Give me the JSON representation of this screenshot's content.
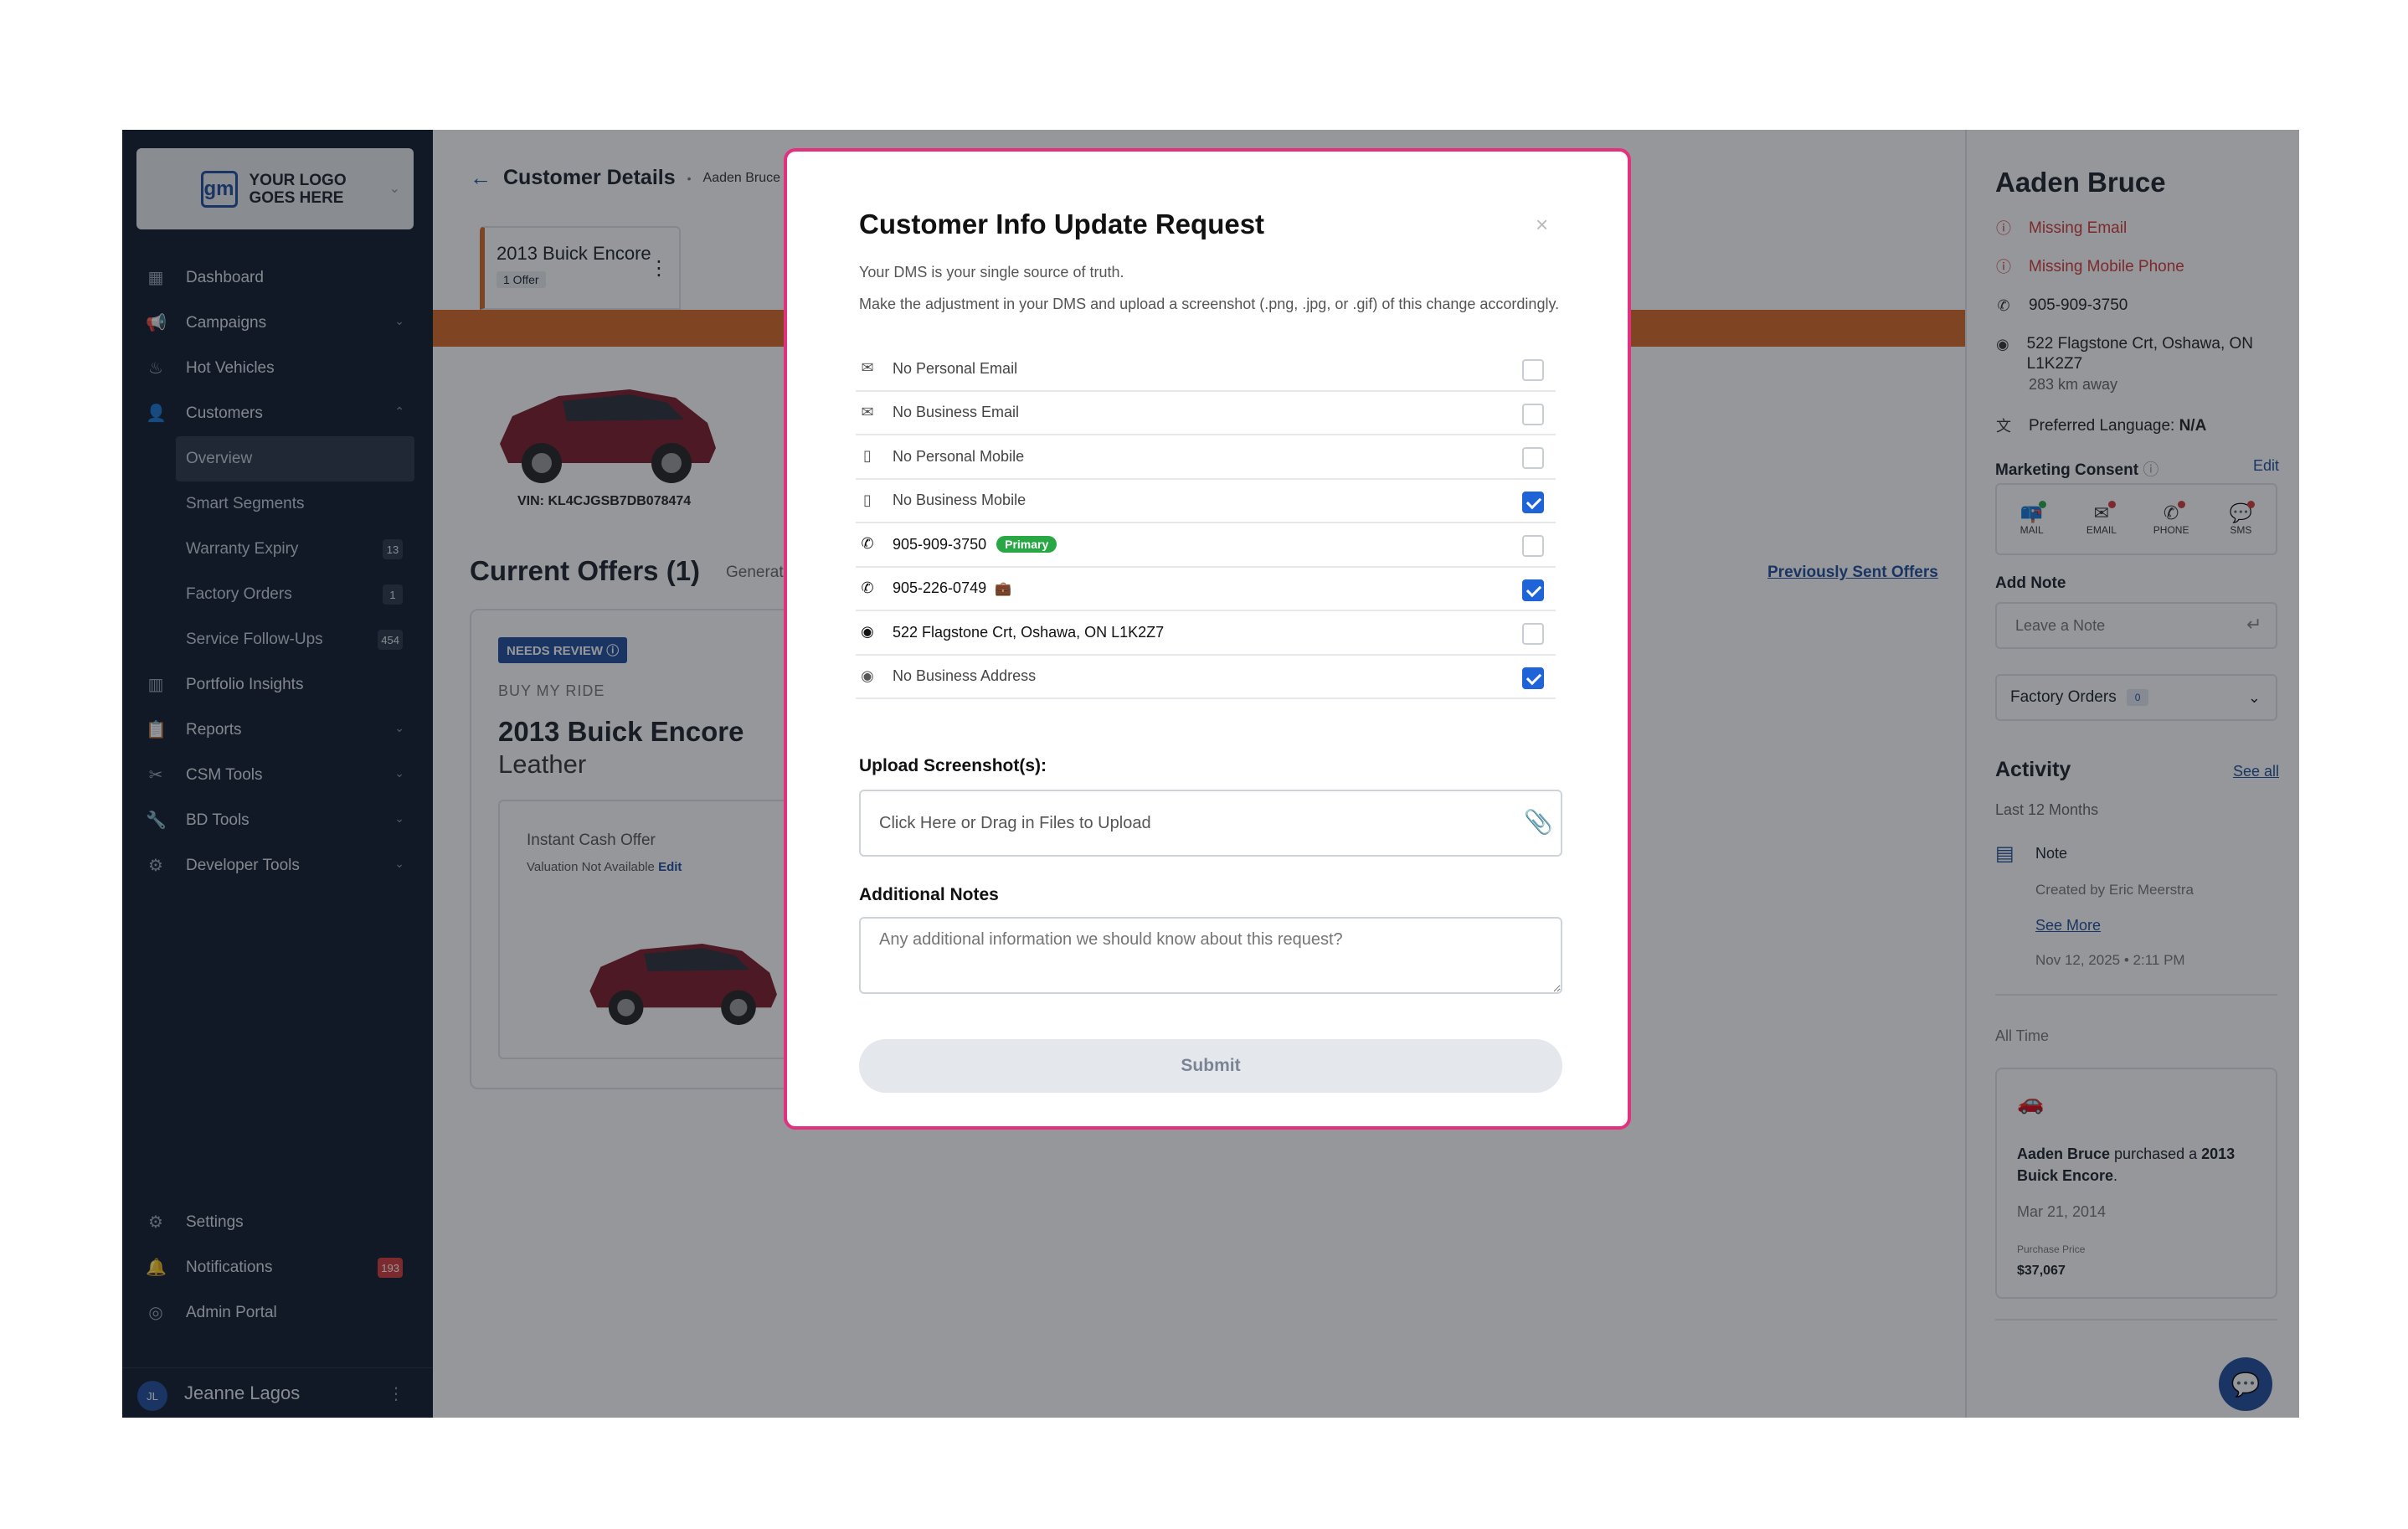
{
  "sidebar": {
    "logo_text": "YOUR LOGO GOES HERE",
    "logo_mark": "gm",
    "items": [
      {
        "label": "Dashboard",
        "icon": "dashboard-icon"
      },
      {
        "label": "Campaigns",
        "icon": "megaphone-icon",
        "expandable": true
      },
      {
        "label": "Hot Vehicles",
        "icon": "flame-icon"
      },
      {
        "label": "Customers",
        "icon": "person-icon",
        "expanded": true
      }
    ],
    "customer_sub": [
      {
        "label": "Overview",
        "active": true
      },
      {
        "label": "Smart Segments"
      },
      {
        "label": "Warranty Expiry",
        "count": "13"
      },
      {
        "label": "Factory Orders",
        "count": "1"
      },
      {
        "label": "Service Follow-Ups",
        "count": "454"
      }
    ],
    "items2": [
      {
        "label": "Portfolio Insights",
        "icon": "chart-icon"
      },
      {
        "label": "Reports",
        "icon": "clipboard-icon",
        "expandable": true
      },
      {
        "label": "CSM Tools",
        "icon": "tools-icon",
        "expandable": true
      },
      {
        "label": "BD Tools",
        "icon": "wrench-icon",
        "expandable": true
      },
      {
        "label": "Developer Tools",
        "icon": "gear-icon",
        "expandable": true
      }
    ],
    "bottom": [
      {
        "label": "Settings",
        "icon": "settings-icon"
      },
      {
        "label": "Notifications",
        "icon": "bell-icon",
        "count": "193"
      },
      {
        "label": "Admin Portal",
        "icon": "compass-icon"
      }
    ],
    "user": {
      "initials": "JL",
      "name": "Jeanne Lagos"
    }
  },
  "main": {
    "breadcrumb_title": "Customer Details",
    "breadcrumb_sub": "Aaden Bruce",
    "vehicle_tab": {
      "title": "2013 Buick Encore",
      "badge": "1 Offer"
    },
    "vin": "VIN: KL4CJGSB7DB078474",
    "offers_title": "Current Offers (1)",
    "generated_text": "Generat",
    "previously_sent": "Previously Sent Offers",
    "offer": {
      "badge": "NEEDS REVIEW",
      "category": "BUY MY RIDE",
      "vehicle": "2013 Buick Encore",
      "trim": "Leather",
      "ico_title": "Instant Cash Offer",
      "ico_sub": "Valuation Not Available",
      "ico_edit": "Edit"
    },
    "car_color": "#7a1a2a"
  },
  "right": {
    "name": "Aaden Bruce",
    "missing_email": "Missing Email",
    "missing_mobile": "Missing Mobile Phone",
    "phone": "905-909-3750",
    "address": "522 Flagstone Crt, Oshawa, ON L1K2Z7",
    "distance": "283 km away",
    "language_label": "Preferred Language:",
    "language_value": "N/A",
    "consent_label": "Marketing Consent",
    "consent_edit": "Edit",
    "consent": [
      {
        "label": "MAIL",
        "status": "ok"
      },
      {
        "label": "EMAIL",
        "status": "no"
      },
      {
        "label": "PHONE",
        "status": "no"
      },
      {
        "label": "SMS",
        "status": "no"
      }
    ],
    "add_note_label": "Add Note",
    "note_placeholder": "Leave a Note",
    "factory_orders": "Factory Orders",
    "factory_count": "0",
    "activity_title": "Activity",
    "see_all": "See all",
    "period": "Last 12 Months",
    "note_title": "Note",
    "note_by": "Created by Eric Meerstra",
    "see_more": "See More",
    "note_date": "Nov 12, 2025 • 2:11 PM",
    "all_time": "All Time",
    "purchase": {
      "who": "Aaden Bruce",
      "verb": " purchased a ",
      "vehicle": "2013 Buick Encore",
      "period_end": ".",
      "date": "Mar 21, 2014",
      "price_label": "Purchase Price",
      "price": "$37,067"
    }
  },
  "modal": {
    "title": "Customer Info Update Request",
    "close": "×",
    "desc1": "Your DMS is your single source of truth.",
    "desc2": "Make the adjustment in your DMS and upload a screenshot (.png, .jpg, or .gif) of this change accordingly.",
    "rows": [
      {
        "label": "No Personal Email",
        "icon": "mail-icon",
        "checked": false,
        "strong": false
      },
      {
        "label": "No Business Email",
        "icon": "mail-icon",
        "checked": false,
        "strong": false
      },
      {
        "label": "No Personal Mobile",
        "icon": "mobile-icon",
        "checked": false,
        "strong": false
      },
      {
        "label": "No Business Mobile",
        "icon": "mobile-icon",
        "checked": true,
        "strong": false
      },
      {
        "label": "905-909-3750",
        "icon": "phone-icon",
        "checked": false,
        "strong": true,
        "badge": "Primary"
      },
      {
        "label": "905-226-0749",
        "icon": "phone-icon",
        "checked": true,
        "strong": true,
        "briefcase": true
      },
      {
        "label": "522 Flagstone Crt, Oshawa, ON L1K2Z7",
        "icon": "location-icon",
        "checked": false,
        "strong": true
      },
      {
        "label": "No Business Address",
        "icon": "location-icon",
        "checked": true,
        "strong": false
      }
    ],
    "upload_label": "Upload Screenshot(s):",
    "upload_placeholder": "Click Here or Drag in Files to Upload",
    "notes_label": "Additional Notes",
    "notes_placeholder": "Any additional information we should know about this request?",
    "submit": "Submit"
  },
  "colors": {
    "accent": "#1f4e9c",
    "orange": "#d86a27",
    "modal_border": "#e3317f",
    "checkbox": "#1e64d8"
  }
}
